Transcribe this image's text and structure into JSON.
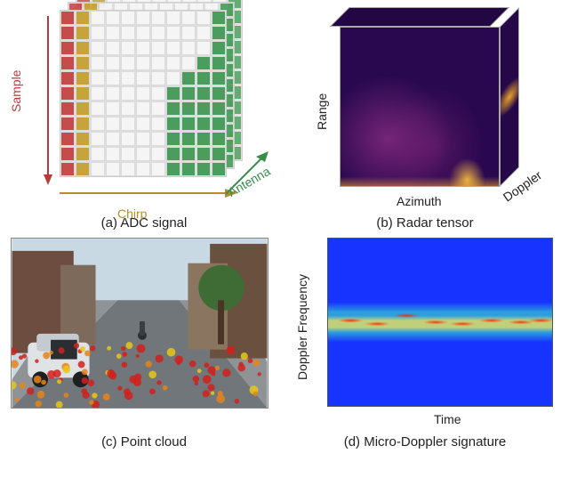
{
  "panels": {
    "a": {
      "caption": "(a) ADC signal",
      "yaxis": "Sample",
      "xaxis": "Chirp",
      "zaxis": "Antenna"
    },
    "b": {
      "caption": "(b) Radar tensor",
      "yaxis": "Range",
      "xaxis": "Azimuth",
      "zaxis": "Doppler"
    },
    "c": {
      "caption": "(c) Point cloud"
    },
    "d": {
      "caption": "(d) Micro-Doppler signature",
      "yaxis": "Doppler Frequency",
      "xaxis": "Time"
    }
  },
  "chart_data": [
    {
      "type": "heatmap",
      "panel": "a",
      "title": "ADC signal",
      "xlabel": "Chirp",
      "ylabel": "Sample",
      "zlabel": "Antenna",
      "grid_rows": 11,
      "grid_cols": 11,
      "layers": 3,
      "color_legend": {
        "red": "Sample axis (column 1)",
        "yellow": "Chirp axis (column 2)",
        "green": "Antenna axis (right stair)"
      },
      "green_stair_start_col_by_row": [
        11,
        11,
        11,
        10,
        9,
        8,
        8,
        8,
        8,
        8,
        8
      ]
    },
    {
      "type": "heatmap",
      "panel": "b",
      "title": "Radar tensor",
      "xlabel": "Azimuth",
      "ylabel": "Range",
      "zlabel": "Doppler",
      "colormap": "viridis-like (dark purple → magenta → yellow)"
    },
    {
      "type": "scatter",
      "panel": "c",
      "title": "Point cloud over camera image",
      "note": "radar detections overlaid on street scene; dots colored red→yellow by range/intensity",
      "approx_point_count": 90
    },
    {
      "type": "heatmap",
      "panel": "d",
      "title": "Micro-Doppler signature",
      "xlabel": "Time",
      "ylabel": "Doppler Frequency",
      "colormap": "jet (blue low → red high)",
      "note": "sinusoid-like oscillating ridge centered near zero Doppler with ~8 peaks across frame"
    }
  ]
}
